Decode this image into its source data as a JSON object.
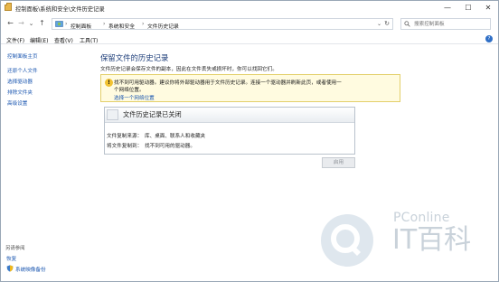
{
  "window": {
    "title": "控制面板\\系统和安全\\文件历史记录",
    "controls": {
      "minimize": "—",
      "maximize": "☐",
      "close": "✕"
    }
  },
  "nav": {
    "back": "←",
    "forward": "→",
    "recent": "⌄",
    "up": "↑",
    "breadcrumbs": [
      "控制面板",
      "系统和安全",
      "文件历史记录"
    ],
    "crumb_separator": "›",
    "search_placeholder": "搜索控制面板"
  },
  "menu": {
    "items": [
      "文件(F)",
      "编辑(E)",
      "查看(V)",
      "工具(T)"
    ],
    "help": "?"
  },
  "sidebar": {
    "home": "控制面板主页",
    "links": [
      "还原个人文件",
      "选择驱动器",
      "排除文件夹",
      "高级设置"
    ],
    "see_also_heading": "另请参阅",
    "bottom_links": [
      "恢复",
      "系统映像备份"
    ]
  },
  "main": {
    "title": "保留文件的历史记录",
    "description": "文件历史记录会保存文件的副本，因此在文件丢失或损坏时，你可以找回它们。",
    "warning": {
      "line1": "找不到可用驱动器。建议你将外部驱动器用于文件历史记录。连接一个驱动器并刷新此页，或者使用一",
      "line2": "个网络位置。",
      "link": "选择一个网络位置"
    },
    "status": {
      "title": "文件历史记录已关闭",
      "copy_from_label": "文件复制来源：",
      "copy_from_value": "库、桌面、联系人和收藏夹",
      "copy_to_label": "将文件复制到：",
      "copy_to_value": "找不到可用的驱动器。"
    },
    "enable_button": "启用"
  },
  "watermark": {
    "brand_top": "PConline",
    "brand_main": "IT百科"
  },
  "colors": {
    "link": "#1a56b0",
    "heading": "#1f3f7a",
    "warning_bg": "#fffbe0",
    "warning_border": "#e3cf6a"
  }
}
